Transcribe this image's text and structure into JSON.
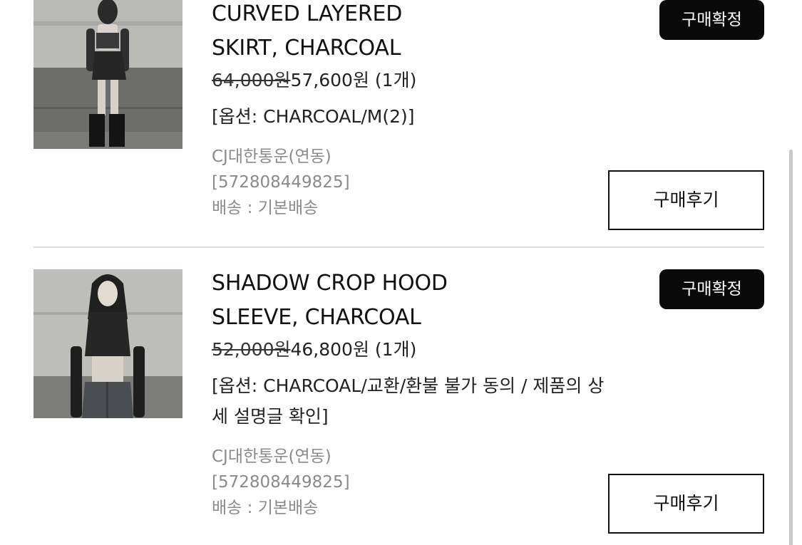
{
  "orders": [
    {
      "image_alt": "CURVED LAYERED SKIRT product photo",
      "title": "CURVED LAYERED\nSKIRT, CHARCOAL",
      "price_original": "64,000원",
      "price_sale": "57,600원",
      "quantity": "(1개)",
      "option": "[옵션: CHARCOAL/M(2)]",
      "carrier": "CJ대한통운(연동)",
      "tracking": "[572808449825]",
      "shipping_method": "배송 : 기본배송",
      "confirm_label": "구매확정",
      "review_label": "구매후기"
    },
    {
      "image_alt": "SHADOW CROP HOOD SLEEVE product photo",
      "title": "SHADOW CROP HOOD\nSLEEVE, CHARCOAL",
      "price_original": "52,000원",
      "price_sale": "46,800원",
      "quantity": "(1개)",
      "option": "[옵션: CHARCOAL/교환/환불 불가 동의 / 제품의 상세 설명글 확인]",
      "carrier": "CJ대한통운(연동)",
      "tracking": "[572808449825]",
      "shipping_method": "배송 : 기본배송",
      "confirm_label": "구매확정",
      "review_label": "구매후기"
    }
  ],
  "colors": {
    "confirm_button_bg": "#0a0a0a",
    "secondary_text": "#8a8a8a",
    "divider": "#dddddd"
  }
}
